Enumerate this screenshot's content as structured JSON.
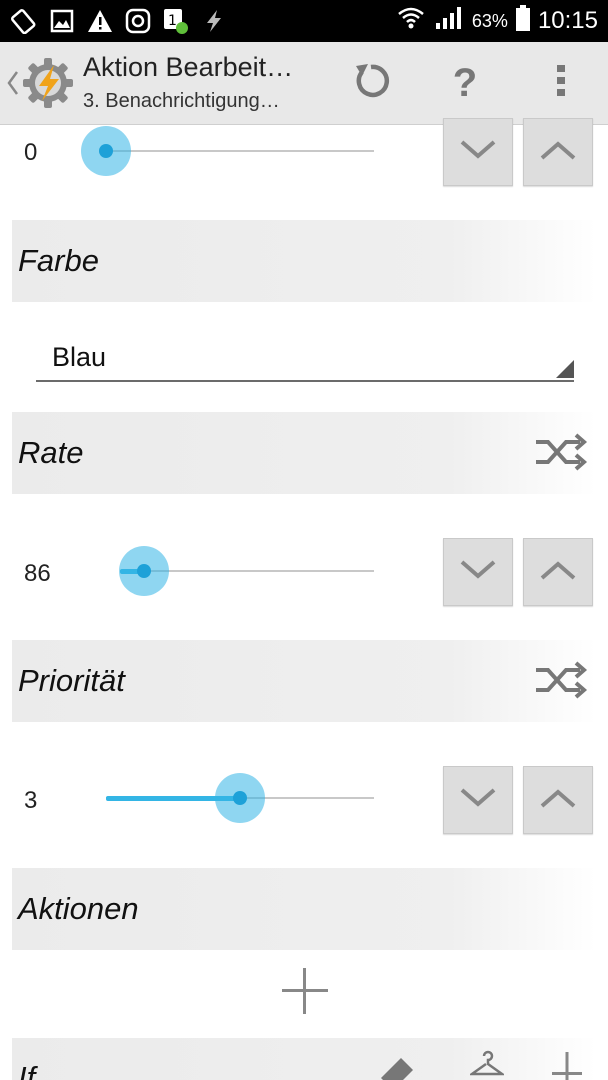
{
  "status_bar": {
    "battery": "63%",
    "time": "10:15",
    "left_icons": [
      "screen-rotation-icon",
      "image-icon",
      "warning-icon",
      "at-sign-icon",
      "notification-badge-icon",
      "tasker-icon"
    ],
    "right_icons": [
      "wifi-icon",
      "signal-icon",
      "battery-icon"
    ]
  },
  "action_bar": {
    "title": "Aktion Bearbeit…",
    "subtitle": "3. Benachrichtigung…",
    "icons": [
      "back-chevron-icon",
      "app-logo-icon",
      "undo-icon",
      "help-icon",
      "overflow-menu-icon"
    ],
    "help_label": "?"
  },
  "sections": {
    "top_slider": {
      "value": "0",
      "fraction": 0.0
    },
    "farbe": {
      "label": "Farbe",
      "selected": "Blau"
    },
    "rate": {
      "label": "Rate",
      "value": "86",
      "fraction": 0.08
    },
    "prioritaet": {
      "label": "Priorität",
      "value": "3",
      "fraction": 0.5
    },
    "aktionen": {
      "label": "Aktionen"
    },
    "if": {
      "label": "If"
    }
  },
  "colors": {
    "accent": "#33b5e5",
    "header_bg": "#ebebeb",
    "stepper_bg": "#dddddd"
  }
}
